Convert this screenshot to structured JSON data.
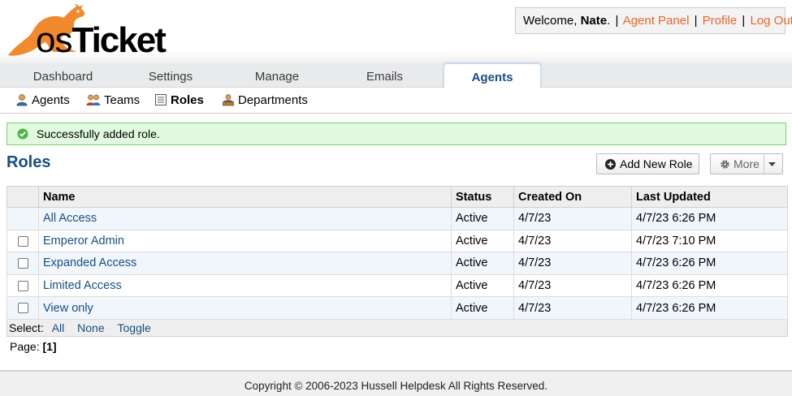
{
  "app": {
    "logo_text_os": "os",
    "logo_text_ticket": "Ticket",
    "brand_color": "#e8842c"
  },
  "header": {
    "welcome_prefix": "Welcome, ",
    "user_name": "Nate",
    "welcome_suffix": ".",
    "links": [
      {
        "label": "Agent Panel"
      },
      {
        "label": "Profile"
      },
      {
        "label": "Log Out"
      }
    ],
    "separator": "|"
  },
  "tabs": [
    {
      "label": "Dashboard",
      "active": false
    },
    {
      "label": "Settings",
      "active": false
    },
    {
      "label": "Manage",
      "active": false
    },
    {
      "label": "Emails",
      "active": false
    },
    {
      "label": "Agents",
      "active": true
    }
  ],
  "subnav": [
    {
      "label": "Agents",
      "icon": "agent-icon",
      "active": false
    },
    {
      "label": "Teams",
      "icon": "teams-icon",
      "active": false
    },
    {
      "label": "Roles",
      "icon": "list-icon",
      "active": true
    },
    {
      "label": "Departments",
      "icon": "department-icon",
      "active": false
    }
  ],
  "message": {
    "text": "Successfully added role.",
    "icon": "check-circle-icon",
    "color": "#77d16e"
  },
  "page": {
    "title": "Roles",
    "add_button": "Add New Role",
    "more_button": "More"
  },
  "table": {
    "columns": [
      "Name",
      "Status",
      "Created On",
      "Last Updated"
    ],
    "rows": [
      {
        "name": "All Access",
        "status": "Active",
        "created": "4/7/23",
        "updated": "4/7/23 6:26 PM",
        "checkbox": false
      },
      {
        "name": "Emperor Admin",
        "status": "Active",
        "created": "4/7/23",
        "updated": "4/7/23 7:10 PM",
        "checkbox": true
      },
      {
        "name": "Expanded Access",
        "status": "Active",
        "created": "4/7/23",
        "updated": "4/7/23 6:26 PM",
        "checkbox": true
      },
      {
        "name": "Limited Access",
        "status": "Active",
        "created": "4/7/23",
        "updated": "4/7/23 6:26 PM",
        "checkbox": true
      },
      {
        "name": "View only",
        "status": "Active",
        "created": "4/7/23",
        "updated": "4/7/23 6:26 PM",
        "checkbox": true
      }
    ],
    "select_label": "Select:",
    "select_all": "All",
    "select_none": "None",
    "select_toggle": "Toggle"
  },
  "pager": {
    "label": "Page:",
    "current": "[1]"
  },
  "footer": {
    "text": "Copyright © 2006-2023 Hussell Helpdesk All Rights Reserved."
  }
}
